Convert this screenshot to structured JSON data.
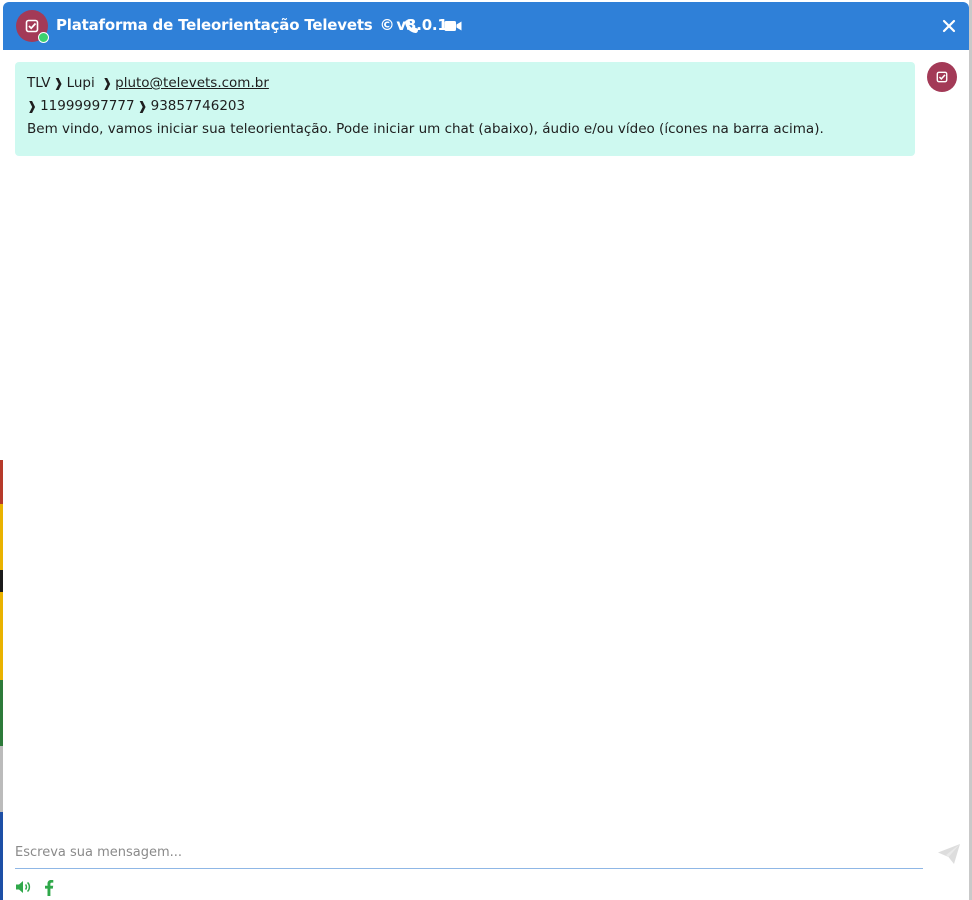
{
  "window": {
    "title": "Plataforma de Teleorientação Televets",
    "copyright_symbol": "©",
    "version": "v3.0.1",
    "accent_color": "#2f80d8",
    "avatar_color": "#a33a57",
    "online_status_color": "#3bd16f"
  },
  "toolbar": {
    "phone_icon": "phone-icon",
    "video_icon": "video-camera-icon",
    "close_icon": "close-icon"
  },
  "message": {
    "bubble_color": "#cef9f0",
    "line1_prefix": "TLV",
    "separator": "❱",
    "name": "Lupi",
    "email": "pluto@televets.com.br",
    "phone1": "11999997777",
    "phone2": "93857746203",
    "text": "Bem vindo, vamos iniciar sua teleorientação. Pode iniciar um chat (abaixo), áudio e/ou vídeo (ícones na barra acima)."
  },
  "composer": {
    "placeholder": "Escreva sua mensagem...",
    "value": "",
    "send_icon": "send-icon"
  },
  "footer": {
    "sound_icon": "speaker-icon",
    "facebook_icon": "facebook-icon",
    "icon_color": "#2fa84a"
  }
}
